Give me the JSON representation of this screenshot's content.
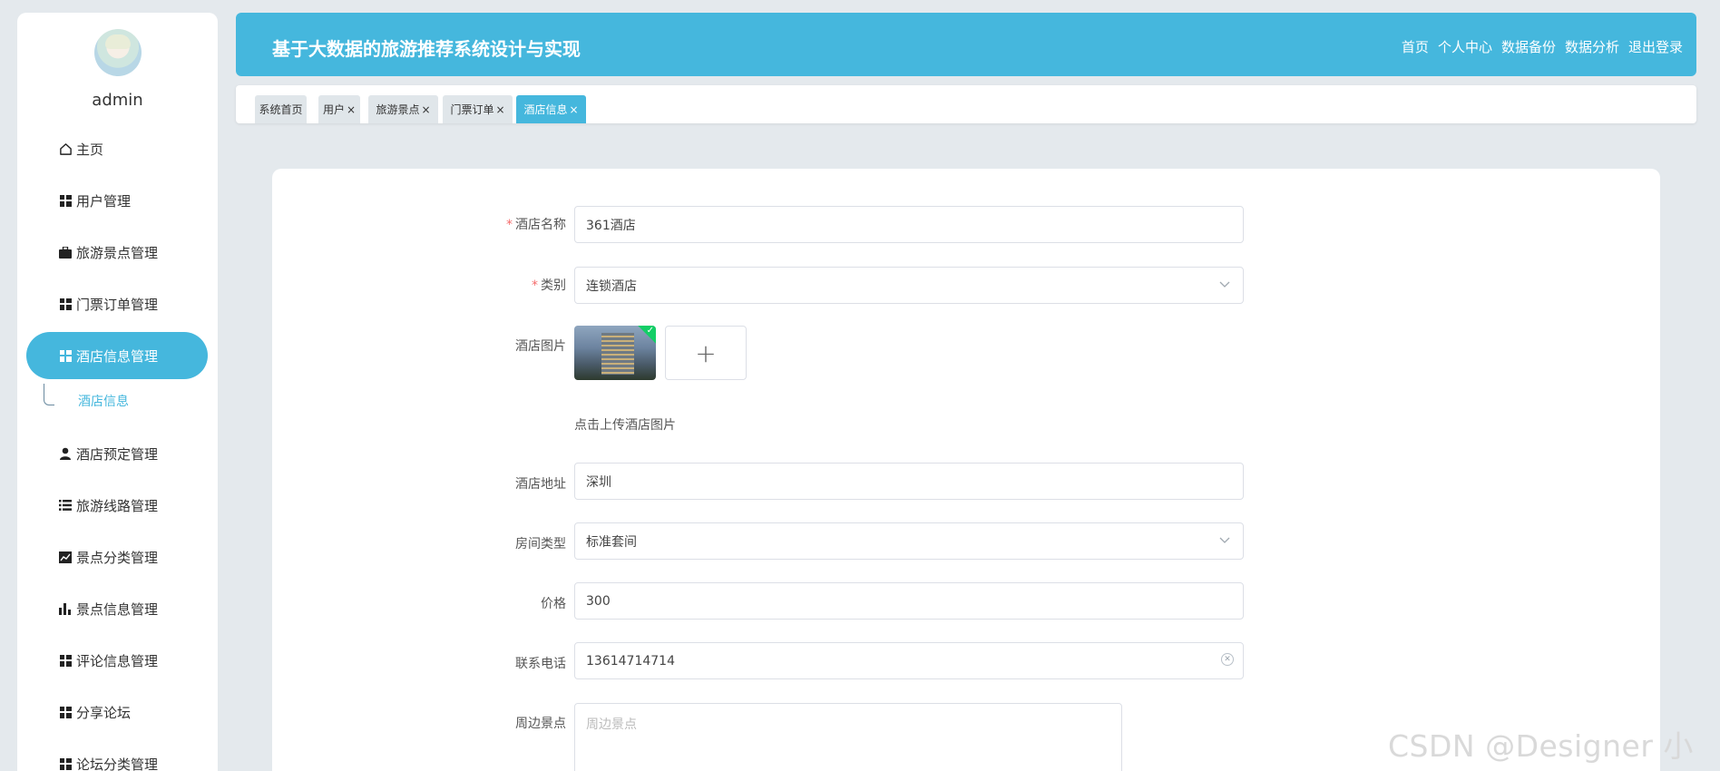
{
  "sidebar": {
    "user_name": "admin",
    "items": [
      {
        "label": "主页",
        "icon": "home-icon"
      },
      {
        "label": "用户管理",
        "icon": "grid-icon"
      },
      {
        "label": "旅游景点管理",
        "icon": "briefcase-icon"
      },
      {
        "label": "门票订单管理",
        "icon": "grid-icon"
      },
      {
        "label": "酒店信息管理",
        "icon": "grid-icon"
      },
      {
        "label": "酒店预定管理",
        "icon": "user-icon"
      },
      {
        "label": "旅游线路管理",
        "icon": "list-icon"
      },
      {
        "label": "景点分类管理",
        "icon": "trend-chart-icon"
      },
      {
        "label": "景点信息管理",
        "icon": "bar-chart-icon"
      },
      {
        "label": "评论信息管理",
        "icon": "grid-icon"
      },
      {
        "label": "分享论坛",
        "icon": "grid-icon"
      },
      {
        "label": "论坛分类管理",
        "icon": "grid-icon"
      }
    ],
    "active_item": "酒店信息管理",
    "sub_item": "酒店信息",
    "accent_color": "#45b7dd"
  },
  "header": {
    "title": "基于大数据的旅游推荐系统设计与实现",
    "nav": [
      "首页",
      "个人中心",
      "数据备份",
      "数据分析",
      "退出登录"
    ]
  },
  "tabs": [
    {
      "label": "系统首页",
      "closable": false
    },
    {
      "label": "用户",
      "closable": true
    },
    {
      "label": "旅游景点",
      "closable": true
    },
    {
      "label": "门票订单",
      "closable": true
    },
    {
      "label": "酒店信息",
      "closable": true,
      "active": true
    }
  ],
  "tab_close_glyph": "×",
  "form": {
    "hotel_name": {
      "label": "酒店名称",
      "value": "361酒店",
      "required": true
    },
    "category": {
      "label": "类别",
      "value": "连锁酒店",
      "required": true
    },
    "image": {
      "label": "酒店图片",
      "tip": "点击上传酒店图片"
    },
    "address": {
      "label": "酒店地址",
      "value": "深圳"
    },
    "room_type": {
      "label": "房间类型",
      "value": "标准套间"
    },
    "price": {
      "label": "价格",
      "value": "300"
    },
    "phone": {
      "label": "联系电话",
      "value": "13614714714"
    },
    "nearby": {
      "label": "周边景点",
      "placeholder": "周边景点"
    }
  },
  "watermark": "CSDN @Designer 小郑"
}
